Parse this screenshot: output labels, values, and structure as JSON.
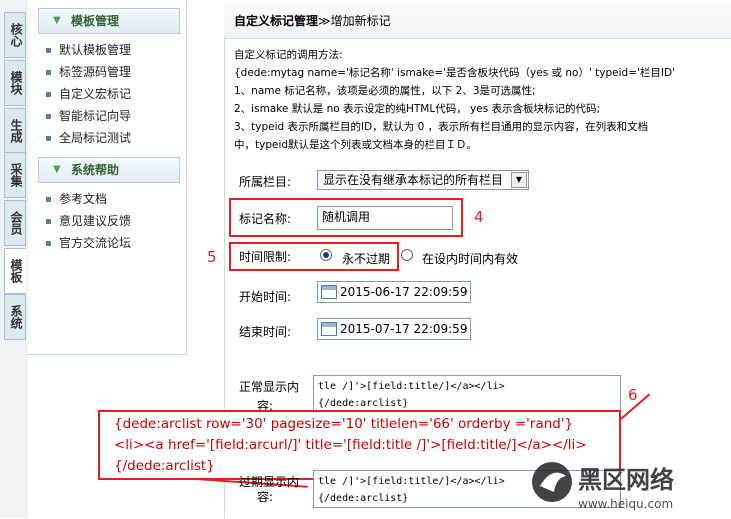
{
  "left_tabs": [
    "核心",
    "模块",
    "生成",
    "采集",
    "会员",
    "模板",
    "系统"
  ],
  "active_tab": "模板",
  "sidebar": {
    "sections": [
      {
        "title": "模板管理",
        "items": [
          "默认模板管理",
          "标签源码管理",
          "自定义宏标记",
          "智能标记向导",
          "全局标记测试"
        ]
      },
      {
        "title": "系统帮助",
        "items": [
          "参考文档",
          "意见建议反馈",
          "官方交流论坛"
        ]
      }
    ]
  },
  "header": {
    "title": "自定义标记管理",
    "separator": "≫",
    "subtitle": "增加新标记"
  },
  "help": {
    "lines": [
      "自定义标记的调用方法:",
      "{dede:mytag name='标记名称' ismake='是否含板块代码（yes 或 no）' typeid='栏目ID'",
      "1、name 标记名称，该项是必须的属性，以下 2、3是可选属性;",
      "2、ismake 默认是 no 表示设定的纯HTML代码， yes 表示含板块标记的代码;",
      "3、typeid 表示所属栏目的ID，默认为 0 ，表示所有栏目通用的显示内容，在列表和文档",
      "中，typeid默认是这个列表或文档本身的栏目ＩＤ。"
    ]
  },
  "form": {
    "category_label": "所属栏目:",
    "category_value": "显示在没有继承本标记的所有栏目",
    "tag_name_label": "标记名称:",
    "tag_name_value": "随机调用",
    "time_limit_label": "时间限制:",
    "time_option_1": "永不过期",
    "time_option_2": "在设内时间内有效",
    "start_label": "开始时间:",
    "start_value": "2015-06-17 22:09:59",
    "end_label": "结束时间:",
    "end_value": "2015-07-17 22:09:59",
    "normal_label_1": "正常显示内",
    "normal_label_2": "容:",
    "normal_content": "tle /]'>[field:title/]</a></li>\n{/dede:arclist}",
    "expired_label_1": "过期显示内",
    "expired_label_2": "容:",
    "expired_content": "tle /]'>[field:title/]</a></li>\n{/dede:arclist}"
  },
  "annotations": {
    "num4": "4",
    "num5": "5",
    "num6": "6",
    "callout": [
      "{dede:arclist row='30' pagesize='10' titlelen='66' orderby ='rand'}",
      "<li><a href='[field:arcurl/]' title='[field:title /]'>[field:title/]</a></li>",
      "{/dede:arclist}"
    ]
  },
  "watermark": {
    "brand": "黑区网络",
    "url": "www.heiqu.com"
  },
  "colors": {
    "annotation_red": "#e02020",
    "section_green": "#336633"
  }
}
